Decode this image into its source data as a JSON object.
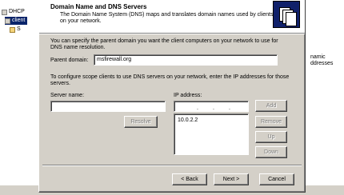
{
  "background": {
    "tree_items": [
      "DHCP",
      "client",
      "S"
    ],
    "right_text": [
      "namic",
      "ddresses"
    ]
  },
  "wizard": {
    "title": "Domain Name and DNS Servers",
    "subtitle": "The Domain Name System (DNS) maps and translates domain names used by clients on your network.",
    "intro": "You can specify the parent domain you want the client computers on your network to use for DNS name resolution.",
    "parent_domain_label": "Parent domain:",
    "parent_domain_value": "msfirewall.org",
    "config_text": "To configure scope clients to use DNS servers on your network, enter the IP addresses for those servers.",
    "server_name_label": "Server name:",
    "server_name_value": "",
    "ip_address_label": "IP address:",
    "ip_value": "",
    "resolve_label": "Resolve",
    "add_label": "Add",
    "remove_label": "Remove",
    "up_label": "Up",
    "down_label": "Down",
    "dns_list": [
      "10.0.2.2"
    ],
    "back_label": "< Back",
    "next_label": "Next >",
    "cancel_label": "Cancel"
  }
}
